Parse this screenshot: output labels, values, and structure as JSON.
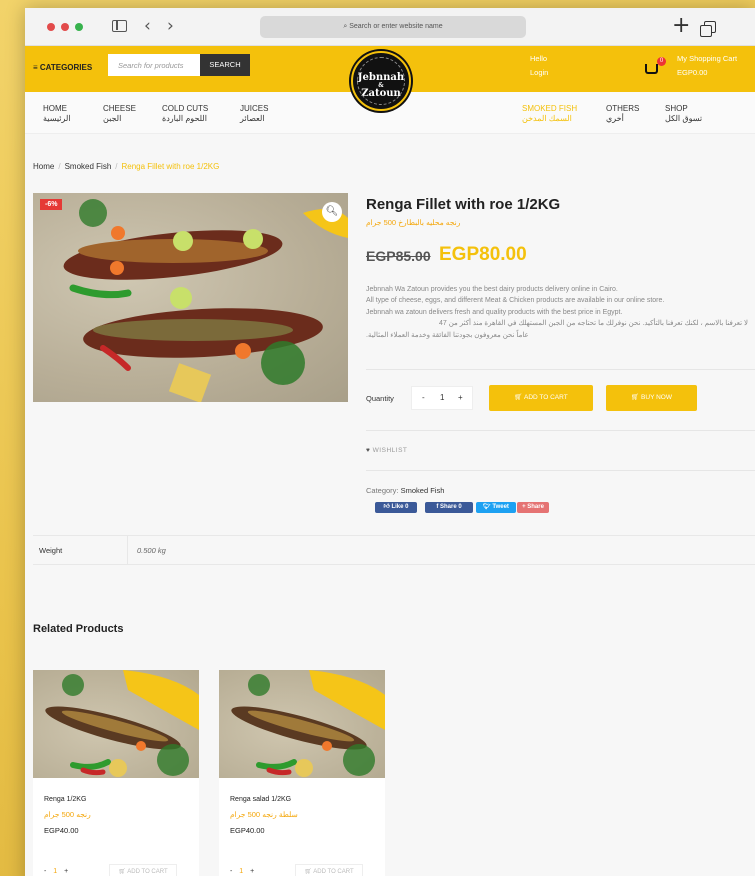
{
  "browser": {
    "url_placeholder": "Search or enter website name"
  },
  "header": {
    "categories_label": "CATEGORIES",
    "search_placeholder": "Search for products",
    "search_button": "SEARCH",
    "logo_line1": "Jebnnah",
    "logo_line2": "&",
    "logo_line3": "Zatoun",
    "hello": "Hello",
    "login": "Login",
    "cart_count": "0",
    "cart_title": "My Shopping Cart",
    "cart_amount": "EGP0.00"
  },
  "nav": {
    "items": [
      {
        "en": "HOME",
        "ar": "الرئيسية"
      },
      {
        "en": "CHEESE",
        "ar": "الجبن"
      },
      {
        "en": "COLD CUTS",
        "ar": "اللحوم الباردة"
      },
      {
        "en": "JUICES",
        "ar": "العصائر"
      },
      {
        "en": "SMOKED FISH",
        "ar": "السمك المدخن"
      },
      {
        "en": "OTHERS",
        "ar": "أخري"
      },
      {
        "en": "SHOP",
        "ar": "تسوق الكل"
      }
    ]
  },
  "breadcrumb": {
    "home": "Home",
    "category": "Smoked Fish",
    "current": "Renga Fillet with roe 1/2KG"
  },
  "product": {
    "sale_badge": "-6%",
    "title": "Renga Fillet with roe 1/2KG",
    "arabic_title": "رنجه محليه بالبطارخ 500 جرام",
    "old_price": "EGP85.00",
    "new_price": "EGP80.00",
    "description": [
      "Jebnnah Wa Zatoun provides you the best dairy products delivery online in Cairo.",
      "All type of cheese, eggs, and different Meat & Chicken products are available in our online store.",
      "Jebnnah wa zatoun delivers fresh and quality products with the best price in Egypt.",
      "لا تعرفنا بالاسم ، لكنك تعرفنا بالتأكيد. نحن نوفرلك ما تحتاجه من الجبن المستهلك في القاهرة منذ أكثر من 47",
      "عاماً نحن معروفون بجودتنا الفائقة وخدمة العملاء المثالية."
    ],
    "quantity_label": "Quantity",
    "quantity_value": "1",
    "add_to_cart": "ADD TO CART",
    "buy_now": "BUY NOW",
    "wishlist": "WISHLIST",
    "category_label": "Category:",
    "category_value": "Smoked Fish",
    "social": {
      "like": "Like 0",
      "share": "Share 0",
      "tweet": "Tweet",
      "share2": "Share"
    }
  },
  "attributes": {
    "weight_label": "Weight",
    "weight_value": "0.500 kg"
  },
  "related": {
    "heading": "Related Products",
    "items": [
      {
        "name": "Renga 1/2KG",
        "arabic": "رنجه 500 جرام",
        "price": "EGP40.00",
        "qty": "1",
        "add": "ADD TO CART"
      },
      {
        "name": "Renga salad 1/2KG",
        "arabic": "سلطة رنجه 500 جرام",
        "price": "EGP40.00",
        "qty": "1",
        "add": "ADD TO CART"
      }
    ]
  },
  "colors": {
    "brand_yellow": "#f4c10c",
    "sale_red": "#e53935",
    "facebook_blue": "#3b5998",
    "twitter_blue": "#1da1f2"
  }
}
